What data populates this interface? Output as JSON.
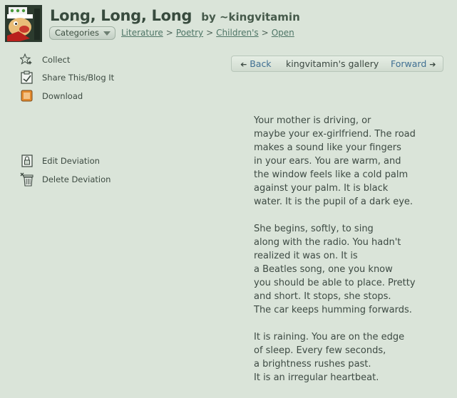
{
  "header": {
    "title": "Long, Long, Long",
    "byline": "by ~kingvitamin",
    "categories_label": "Categories",
    "breadcrumb": [
      "Literature",
      "Poetry",
      "Children's",
      "Open"
    ],
    "breadcrumb_separator": ">"
  },
  "actions": {
    "collect": "Collect",
    "share": "Share This/Blog It",
    "download": "Download",
    "edit": "Edit Deviation",
    "delete": "Delete Deviation"
  },
  "gallery_nav": {
    "back": "Back",
    "gallery": "kingvitamin's gallery",
    "forward": "Forward"
  },
  "poem": {
    "stanzas": [
      [
        "Your mother is driving, or",
        "maybe your ex-girlfriend. The road",
        "makes a sound like your fingers",
        "in your ears. You are warm, and",
        "the window feels like a cold palm",
        "against your palm. It is black",
        "water. It is the pupil of a dark eye."
      ],
      [
        "She begins, softly, to sing",
        "along with the radio. You hadn't",
        "realized it was on. It is",
        "a Beatles song, one you know",
        "you should be able to place. Pretty",
        "and short. It stops, she stops.",
        "The car keeps humming forwards."
      ],
      [
        "It is raining. You are on the edge",
        "of sleep. Every few seconds,",
        "a brightness rushes past.",
        "It is an irregular heartbeat."
      ]
    ]
  },
  "icons": {
    "avatar": "avatar-cartoon-icon",
    "collect": "star-sparkle-icon",
    "share": "share-clipboard-icon",
    "download": "download-box-icon",
    "edit": "edit-lock-icon",
    "delete": "trash-icon",
    "back": "arrow-left-icon",
    "forward": "arrow-right-icon",
    "categories": "chevron-down-icon"
  }
}
